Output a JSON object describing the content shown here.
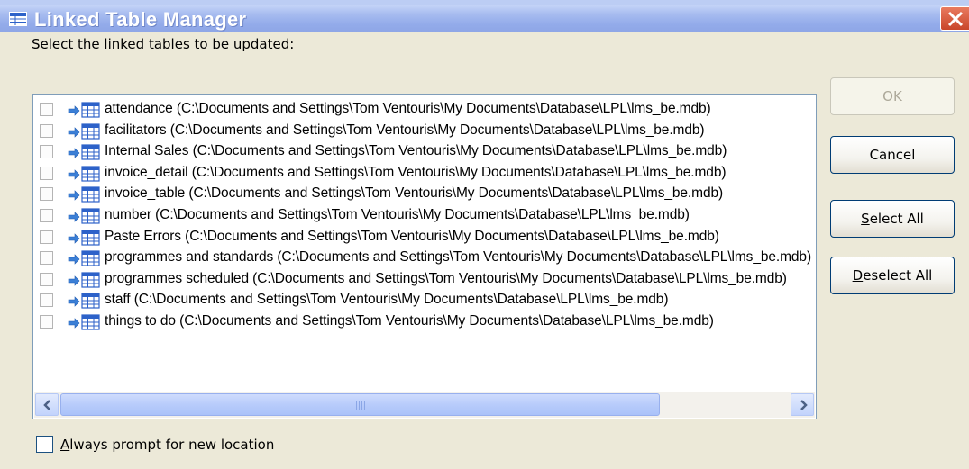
{
  "window": {
    "title": "Linked Table Manager",
    "title_icon": "table-window-icon",
    "close_icon": "close-icon"
  },
  "prompt": {
    "before": "Select the linked ",
    "accel": "t",
    "after": "ables to be updated:"
  },
  "tables": [
    {
      "label": "attendance   (C:\\Documents and Settings\\Tom Ventouris\\My Documents\\Database\\LPL\\lms_be.mdb)",
      "checked": false
    },
    {
      "label": "facilitators   (C:\\Documents and Settings\\Tom Ventouris\\My Documents\\Database\\LPL\\lms_be.mdb)",
      "checked": false
    },
    {
      "label": "Internal Sales   (C:\\Documents and Settings\\Tom Ventouris\\My Documents\\Database\\LPL\\lms_be.mdb)",
      "checked": false
    },
    {
      "label": "invoice_detail   (C:\\Documents and Settings\\Tom Ventouris\\My Documents\\Database\\LPL\\lms_be.mdb)",
      "checked": false
    },
    {
      "label": "invoice_table   (C:\\Documents and Settings\\Tom Ventouris\\My Documents\\Database\\LPL\\lms_be.mdb)",
      "checked": false
    },
    {
      "label": "number   (C:\\Documents and Settings\\Tom Ventouris\\My Documents\\Database\\LPL\\lms_be.mdb)",
      "checked": false
    },
    {
      "label": "Paste Errors   (C:\\Documents and Settings\\Tom Ventouris\\My Documents\\Database\\LPL\\lms_be.mdb)",
      "checked": false
    },
    {
      "label": "programmes and standards   (C:\\Documents and Settings\\Tom Ventouris\\My Documents\\Database\\LPL\\lms_be.mdb)",
      "checked": false
    },
    {
      "label": "programmes scheduled   (C:\\Documents and Settings\\Tom Ventouris\\My Documents\\Database\\LPL\\lms_be.mdb)",
      "checked": false
    },
    {
      "label": "staff   (C:\\Documents and Settings\\Tom Ventouris\\My Documents\\Database\\LPL\\lms_be.mdb)",
      "checked": false
    },
    {
      "label": "things to do   (C:\\Documents and Settings\\Tom Ventouris\\My Documents\\Database\\LPL\\lms_be.mdb)",
      "checked": false
    }
  ],
  "buttons": {
    "ok": {
      "label": "OK",
      "enabled": false
    },
    "cancel": {
      "label": "Cancel"
    },
    "select_all": {
      "accel": "S",
      "rest": "elect All"
    },
    "deselect_all": {
      "accel": "D",
      "rest": "eselect All"
    }
  },
  "always_prompt": {
    "accel": "A",
    "rest": "lways prompt for new location",
    "checked": false
  },
  "colors": {
    "titlebar": "#93abea",
    "dialog_bg": "#ece9d8",
    "button_border": "#003c74",
    "disabled_text": "#aca899"
  }
}
